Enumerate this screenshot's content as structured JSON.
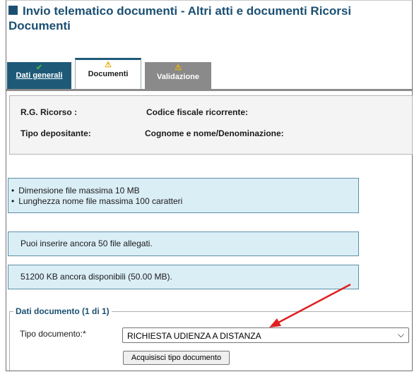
{
  "page": {
    "title": "Invio telematico documenti - Altri atti e documenti Ricorsi Documenti"
  },
  "tabs": [
    {
      "label": "Dati generali",
      "icon": "check-icon",
      "state": "completed"
    },
    {
      "label": "Documenti",
      "icon": "warning-icon",
      "state": "active"
    },
    {
      "label": "Validazione",
      "icon": "warning-icon",
      "state": "inactive"
    }
  ],
  "info": {
    "rg_ricorso_label": "R.G. Ricorso :",
    "codice_fiscale_label": "Codice fiscale ricorrente:",
    "tipo_depositante_label": "Tipo depositante:",
    "cognome_nome_label": "Cognome e nome/Denominazione:"
  },
  "notices": {
    "limits": [
      "Dimensione file massima 10 MB",
      "Lunghezza nome file massima 100 caratteri"
    ],
    "files_remaining": "Puoi inserire ancora 50 file allegati.",
    "kb_remaining": "51200 KB ancora disponibili (50.00 MB)."
  },
  "documento": {
    "legend": "Dati documento (1 di 1)",
    "tipo_label": "Tipo documento:*",
    "tipo_value": "RICHIESTA UDIENZA A DISTANZA",
    "acquisisci_label": "Acquisisci tipo documento"
  },
  "colors": {
    "primary": "#1b4f72",
    "tab_active": "#1e5a78",
    "notice_bg": "#daeef6",
    "arrow": "#e02020"
  }
}
